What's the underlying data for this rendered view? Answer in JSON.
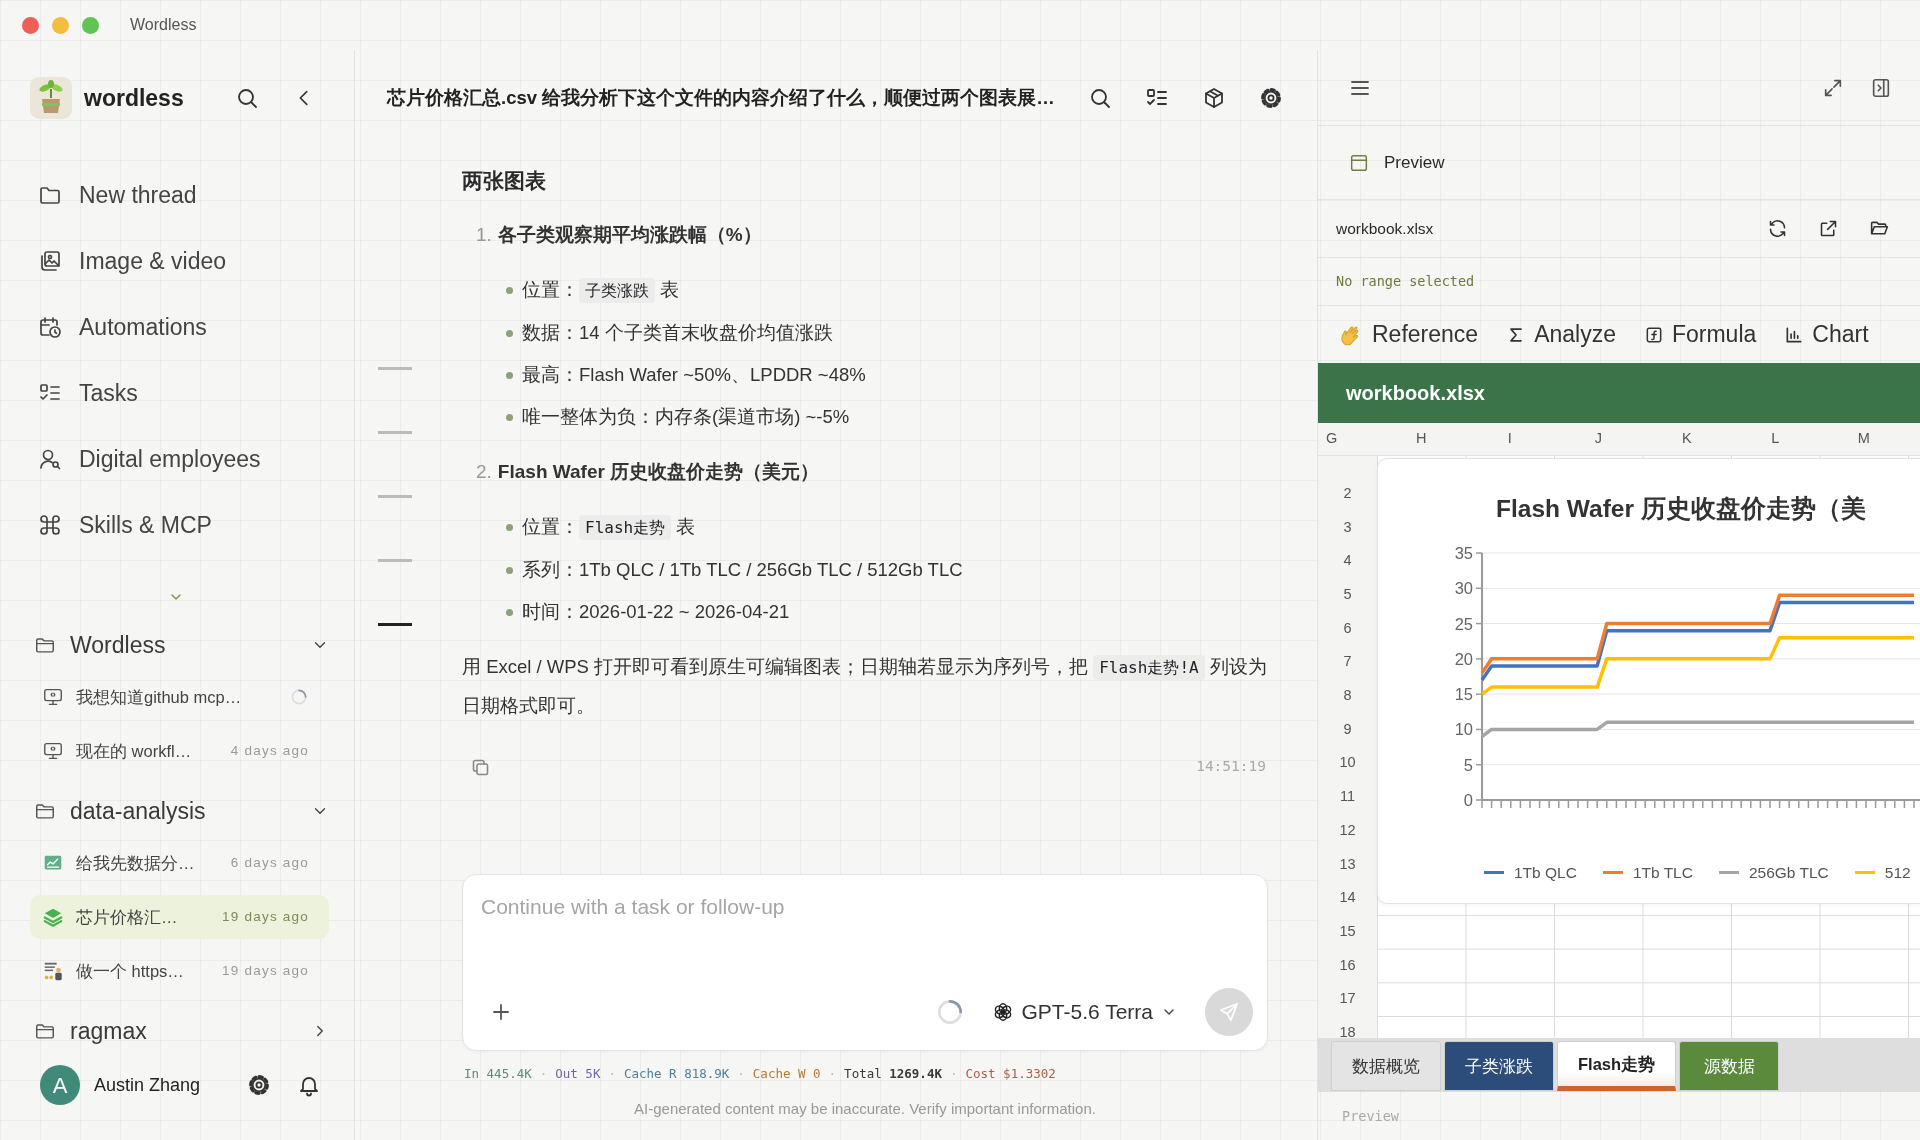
{
  "window": {
    "title": "Wordless"
  },
  "sidebar": {
    "brand": {
      "name": "wordless"
    },
    "nav": [
      {
        "kind": "folder",
        "label": "New thread"
      },
      {
        "kind": "images",
        "label": "Image & video"
      },
      {
        "kind": "calendar",
        "label": "Automations"
      },
      {
        "kind": "checklist",
        "label": "Tasks"
      },
      {
        "kind": "person",
        "label": "Digital employees"
      },
      {
        "kind": "command",
        "label": "Skills & MCP"
      }
    ],
    "space_header": {
      "expanded": true
    },
    "groups": [
      {
        "name": "Wordless",
        "expanded": true,
        "threads": [
          {
            "kind": "monitor",
            "title": "我想知道github mcp…",
            "loading": true,
            "selected": false
          },
          {
            "kind": "monitor",
            "title": "现在的 workfl…",
            "time": "4 days ago",
            "loading": false,
            "selected": false
          }
        ]
      },
      {
        "name": "data-analysis",
        "expanded": true,
        "threads": [
          {
            "kind": "chart",
            "title": "给我先数据分…",
            "time": "6 days ago",
            "loading": false,
            "selected": false
          },
          {
            "kind": "layers",
            "title": "芯片价格汇…",
            "time": "19 days ago",
            "loading": false,
            "selected": true
          },
          {
            "kind": "presenter",
            "title": "做一个 https…",
            "time": "19 days ago",
            "loading": false,
            "selected": false
          }
        ]
      },
      {
        "name": "ragmax",
        "expanded": false
      }
    ],
    "user": {
      "initial": "A",
      "name": "Austin Zhang"
    }
  },
  "conversation": {
    "title": "芯片价格汇总.csv 给我分析下这个文件的内容介绍了什么，顺便过两个图表展…",
    "outline_markers": [
      {
        "selected": false
      },
      {
        "selected": false
      },
      {
        "selected": false
      },
      {
        "selected": false
      },
      {
        "selected": true
      }
    ],
    "heading": "两张图表",
    "sections": [
      {
        "number": "1.",
        "title": "各子类观察期平均涨跌幅（%）",
        "bullets": [
          [
            {
              "kind": "text",
              "text": "位置："
            },
            {
              "kind": "code",
              "text": "子类涨跌"
            },
            {
              "kind": "text",
              "text": " 表"
            }
          ],
          [
            {
              "kind": "text",
              "text": "数据：14 个子类首末收盘价均值涨跌"
            }
          ],
          [
            {
              "kind": "text",
              "text": "最高：Flash Wafer ~50%、LPDDR ~48%"
            }
          ],
          [
            {
              "kind": "text",
              "text": "唯一整体为负：内存条(渠道市场) ~-5%"
            }
          ]
        ]
      },
      {
        "number": "2.",
        "title": "Flash Wafer 历史收盘价走势（美元）",
        "bullets": [
          [
            {
              "kind": "text",
              "text": "位置："
            },
            {
              "kind": "code",
              "text": "Flash走势"
            },
            {
              "kind": "text",
              "text": " 表"
            }
          ],
          [
            {
              "kind": "text",
              "text": "系列：1Tb QLC / 1Tb TLC / 256Gb TLC / 512Gb TLC"
            }
          ],
          [
            {
              "kind": "text",
              "text": "时间：2026-01-22 ~ 2026-04-21"
            }
          ]
        ]
      }
    ],
    "note": [
      {
        "kind": "text",
        "text": "用 Excel / WPS 打开即可看到原生可编辑图表；日期轴若显示为序列号，把 "
      },
      {
        "kind": "code",
        "text": "Flash走势!A"
      },
      {
        "kind": "text",
        "text": " 列设为日期格式即可。"
      }
    ],
    "timestamp": "14:51:19"
  },
  "composer": {
    "placeholder": "Continue with a task or follow-up",
    "model": "GPT-5.6 Terra"
  },
  "usage": [
    {
      "kind": "stat",
      "text": "In 445.4K",
      "color": "#5b8c7b"
    },
    {
      "kind": "separator",
      "text": "·"
    },
    {
      "kind": "stat",
      "text": "Out 5K",
      "color": "#7565a8"
    },
    {
      "kind": "separator",
      "text": "·"
    },
    {
      "kind": "stat",
      "text": "Cache R 818.9K",
      "color": "#4f7e9c"
    },
    {
      "kind": "separator",
      "text": "·"
    },
    {
      "kind": "stat",
      "text": "Cache W 0",
      "color": "#b07c34"
    },
    {
      "kind": "separator",
      "text": "·"
    },
    {
      "kind": "stat",
      "text": "Total **1269.4K**",
      "color": "#3a3a3a"
    },
    {
      "kind": "separator",
      "text": "·"
    },
    {
      "kind": "stat",
      "text": "Cost $1.3302",
      "color": "#a5634c"
    }
  ],
  "disclaimer": "AI-generated content may be inaccurate. Verify important information.",
  "preview_panel": {
    "heading": "Preview",
    "file_name": "workbook.xlsx",
    "range_status": "No range selected",
    "tools": [
      {
        "kind": "hand",
        "label": "Reference"
      },
      {
        "kind": "sigma",
        "label": "Analyze"
      },
      {
        "kind": "formula",
        "label": "Formula"
      },
      {
        "kind": "chart",
        "label": "Chart"
      }
    ],
    "workbook_title": "workbook.xlsx",
    "columns": [
      "G",
      "H",
      "I",
      "J",
      "K",
      "L",
      "M"
    ],
    "rows": [
      "2",
      "3",
      "4",
      "5",
      "6",
      "7",
      "8",
      "9",
      "10",
      "11",
      "12",
      "13",
      "14",
      "15",
      "16",
      "17",
      "18"
    ],
    "chart": {
      "chart_data": {
        "type": "line",
        "title": "Flash Wafer 历史收盘价走势（美",
        "grid": true,
        "legend": true,
        "ylim": [
          0,
          35
        ],
        "yticks": [
          0,
          5,
          10,
          15,
          20,
          25,
          30,
          35
        ],
        "series": [
          {
            "name": "1Tb QLC",
            "color": "#4472c4",
            "values": [
              17,
              19,
              19,
              19,
              19,
              19,
              19,
              19,
              19,
              19,
              19,
              19,
              19,
              24,
              24,
              24,
              24,
              24,
              24,
              24,
              24,
              24,
              24,
              24,
              24,
              24,
              24,
              24,
              24,
              24,
              24,
              28,
              28,
              28,
              28,
              28,
              28,
              28,
              28,
              28,
              28,
              28,
              28,
              28,
              28,
              28
            ]
          },
          {
            "name": "1Tb TLC",
            "color": "#ed7d31",
            "values": [
              18,
              20,
              20,
              20,
              20,
              20,
              20,
              20,
              20,
              20,
              20,
              20,
              20,
              25,
              25,
              25,
              25,
              25,
              25,
              25,
              25,
              25,
              25,
              25,
              25,
              25,
              25,
              25,
              25,
              25,
              25,
              29,
              29,
              29,
              29,
              29,
              29,
              29,
              29,
              29,
              29,
              29,
              29,
              29,
              29,
              29
            ]
          },
          {
            "name": "256Gb TLC",
            "color": "#a5a5a5",
            "values": [
              9,
              10,
              10,
              10,
              10,
              10,
              10,
              10,
              10,
              10,
              10,
              10,
              10,
              11,
              11,
              11,
              11,
              11,
              11,
              11,
              11,
              11,
              11,
              11,
              11,
              11,
              11,
              11,
              11,
              11,
              11,
              11,
              11,
              11,
              11,
              11,
              11,
              11,
              11,
              11,
              11,
              11,
              11,
              11,
              11,
              11
            ]
          },
          {
            "name": "512",
            "color": "#ffc000",
            "values": [
              15,
              16,
              16,
              16,
              16,
              16,
              16,
              16,
              16,
              16,
              16,
              16,
              16,
              20,
              20,
              20,
              20,
              20,
              20,
              20,
              20,
              20,
              20,
              20,
              20,
              20,
              20,
              20,
              20,
              20,
              20,
              23,
              23,
              23,
              23,
              23,
              23,
              23,
              23,
              23,
              23,
              23,
              23,
              23,
              23,
              23
            ]
          }
        ]
      }
    },
    "sheet_tabs": [
      {
        "label": "数据概览",
        "color": "#e4e4e4",
        "selected": false
      },
      {
        "label": "子类涨跌",
        "color": "#2c4d7a",
        "selected": false
      },
      {
        "label": "Flash走势",
        "color": "#c9652f",
        "selected": true
      },
      {
        "label": "源数据",
        "color": "#5b8a3d",
        "selected": false
      }
    ],
    "footer": "Preview"
  }
}
